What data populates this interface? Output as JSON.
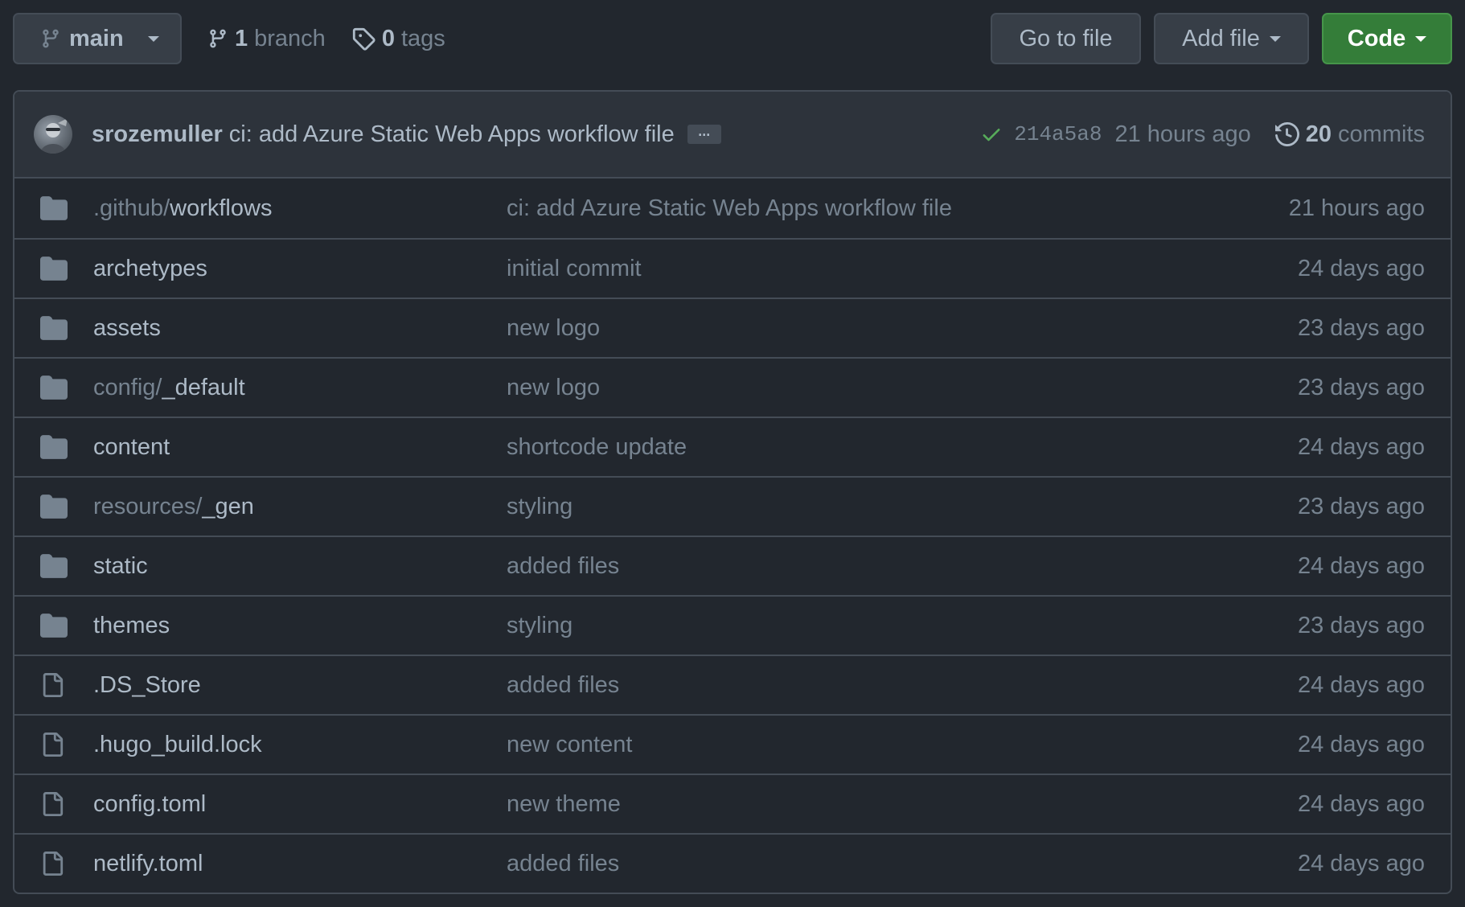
{
  "toolbar": {
    "branch_name": "main",
    "branch_count": "1",
    "branch_label": "branch",
    "tag_count": "0",
    "tag_label": "tags",
    "goto_file_label": "Go to file",
    "add_file_label": "Add file",
    "code_label": "Code"
  },
  "commit": {
    "author": "srozemuller",
    "message": "ci: add Azure Static Web Apps workflow file",
    "ellipsis": "...",
    "status": "success",
    "sha": "214a5a8",
    "time": "21 hours ago",
    "commit_count": "20",
    "commit_count_label": "commits"
  },
  "files": [
    {
      "type": "dir",
      "prefix": ".github/",
      "name": "workflows",
      "message": "ci: add Azure Static Web Apps workflow file",
      "age": "21 hours ago"
    },
    {
      "type": "dir",
      "prefix": "",
      "name": "archetypes",
      "message": "initial commit",
      "age": "24 days ago"
    },
    {
      "type": "dir",
      "prefix": "",
      "name": "assets",
      "message": "new logo",
      "age": "23 days ago"
    },
    {
      "type": "dir",
      "prefix": "config/",
      "name": "_default",
      "message": "new logo",
      "age": "23 days ago"
    },
    {
      "type": "dir",
      "prefix": "",
      "name": "content",
      "message": "shortcode update",
      "age": "24 days ago"
    },
    {
      "type": "dir",
      "prefix": "resources/",
      "name": "_gen",
      "message": "styling",
      "age": "23 days ago"
    },
    {
      "type": "dir",
      "prefix": "",
      "name": "static",
      "message": "added files",
      "age": "24 days ago"
    },
    {
      "type": "dir",
      "prefix": "",
      "name": "themes",
      "message": "styling",
      "age": "23 days ago"
    },
    {
      "type": "file",
      "prefix": "",
      "name": ".DS_Store",
      "message": "added files",
      "age": "24 days ago"
    },
    {
      "type": "file",
      "prefix": "",
      "name": ".hugo_build.lock",
      "message": "new content",
      "age": "24 days ago"
    },
    {
      "type": "file",
      "prefix": "",
      "name": "config.toml",
      "message": "new theme",
      "age": "24 days ago"
    },
    {
      "type": "file",
      "prefix": "",
      "name": "netlify.toml",
      "message": "added files",
      "age": "24 days ago"
    }
  ],
  "colors": {
    "background": "#22272e",
    "header": "#2d333b",
    "border": "#444c56",
    "text": "#adbac7",
    "muted": "#768390",
    "folder_icon": "#768390",
    "success": "#57ab5a",
    "primary_button": "#347d39"
  }
}
